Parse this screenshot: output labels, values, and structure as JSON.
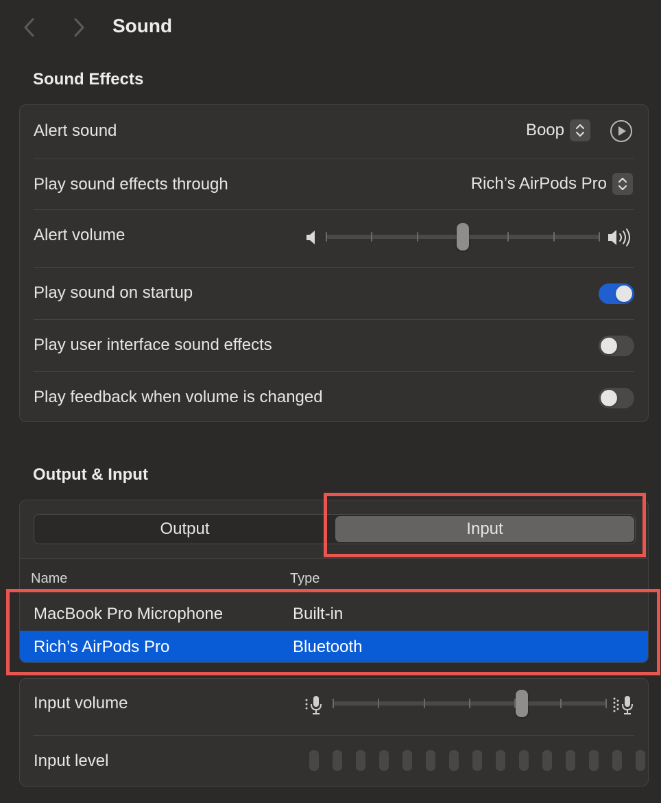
{
  "window": {
    "title": "Sound"
  },
  "sound_effects": {
    "heading": "Sound Effects",
    "alert_sound": {
      "label": "Alert sound",
      "value": "Boop"
    },
    "play_through": {
      "label": "Play sound effects through",
      "value": "Rich’s AirPods Pro"
    },
    "alert_volume": {
      "label": "Alert volume",
      "level": 0.5
    },
    "startup": {
      "label": "Play sound on startup",
      "on": true
    },
    "ui_effects": {
      "label": "Play user interface sound effects",
      "on": false
    },
    "feedback": {
      "label": "Play feedback when volume is changed",
      "on": false
    }
  },
  "output_input": {
    "heading": "Output & Input",
    "tabs": {
      "output": "Output",
      "input": "Input",
      "selected": "input"
    },
    "table": {
      "col_name": "Name",
      "col_type": "Type",
      "rows": [
        {
          "name": "MacBook Pro Microphone",
          "type": "Built-in",
          "selected": false
        },
        {
          "name": "Rich’s AirPods Pro",
          "type": "Bluetooth",
          "selected": true
        }
      ]
    },
    "input_volume": {
      "label": "Input volume",
      "level": 0.7
    },
    "input_level": {
      "label": "Input level",
      "segments": 15,
      "active": 0
    }
  },
  "colors": {
    "accent": "#1f5fd0",
    "selection": "#0a5bd6",
    "annotation": "#e8564f"
  }
}
